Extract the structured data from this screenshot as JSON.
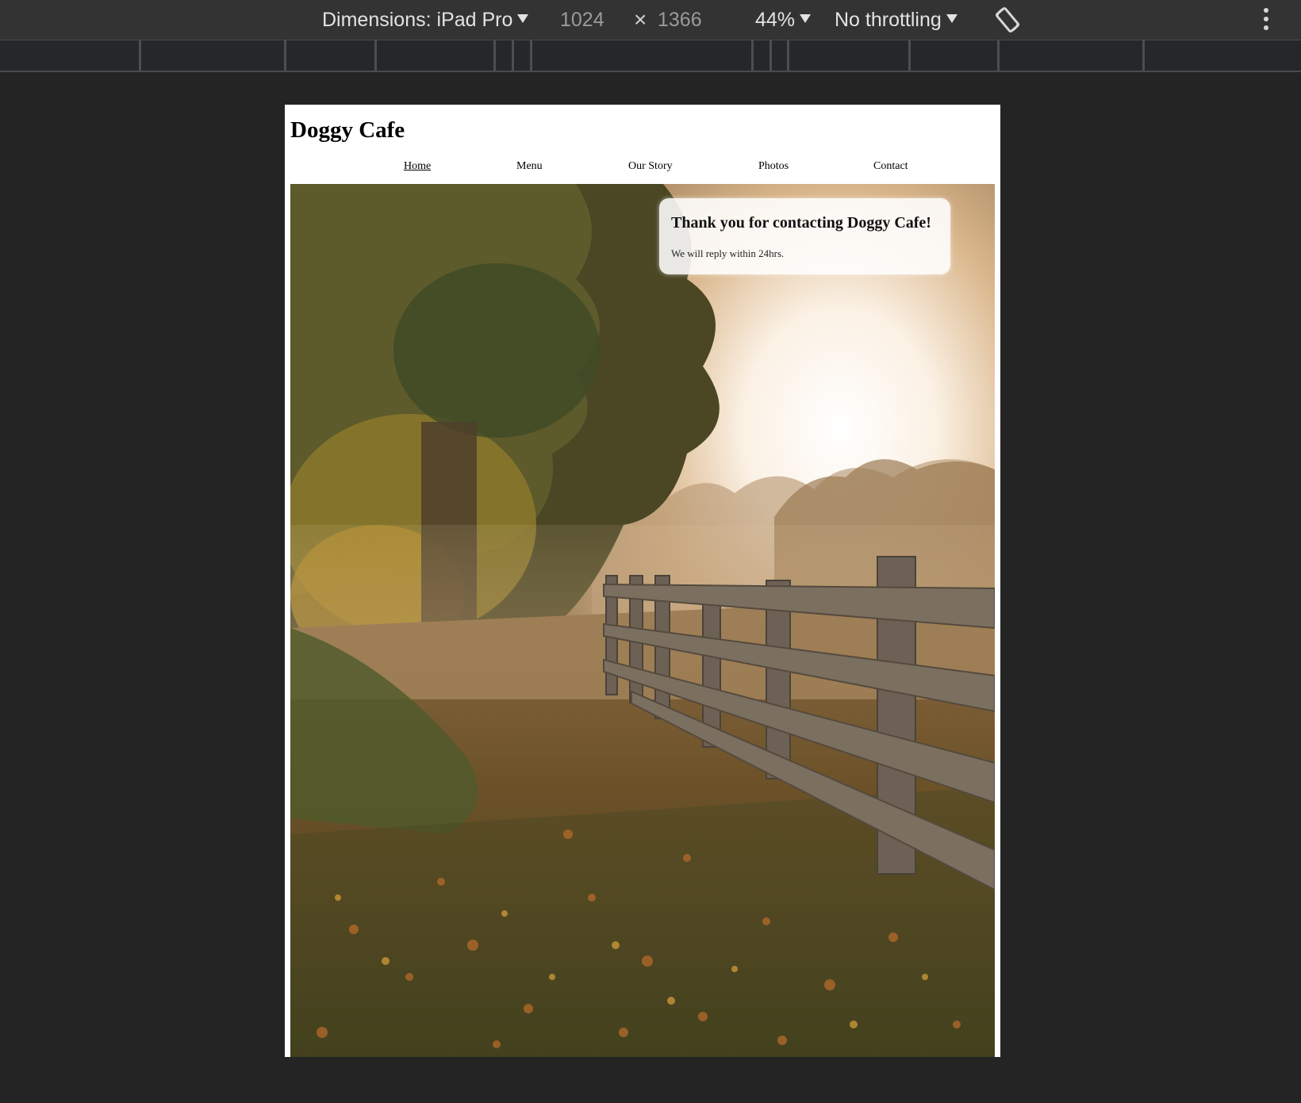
{
  "devtools": {
    "dimensions_label": "Dimensions: iPad Pro",
    "width_value": "1024",
    "times": "×",
    "height_value": "1366",
    "zoom": "44%",
    "throttling": "No throttling"
  },
  "site": {
    "title": "Doggy Cafe",
    "nav": [
      "Home",
      "Menu",
      "Our Story",
      "Photos",
      "Contact"
    ],
    "active_nav": "Home",
    "message": {
      "heading": "Thank you for contacting Doggy Cafe!",
      "body": "We will reply within 24hrs."
    },
    "hero_image": "autumn-path-wooden-fence"
  },
  "icons": [
    "dropdown-caret-icon",
    "rotate-icon",
    "more-vertical-icon"
  ]
}
